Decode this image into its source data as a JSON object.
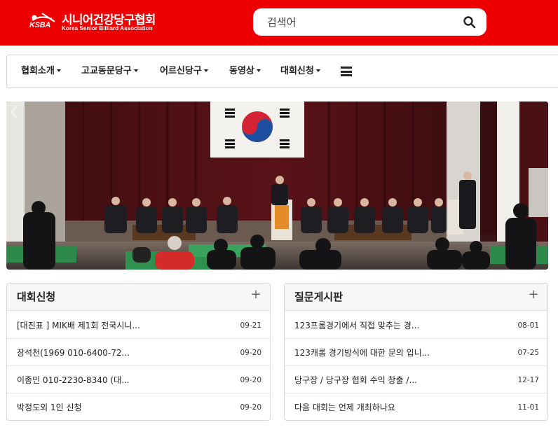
{
  "header": {
    "logo_mark": "KSBA",
    "logo_title": "시니어건강당구협회",
    "logo_subtitle": "Korea Senior Billiard Association",
    "search_placeholder": "검색어",
    "brand_color": "#ee0000"
  },
  "nav": {
    "items": [
      {
        "label": "협회소개"
      },
      {
        "label": "고교동문당구"
      },
      {
        "label": "어르신당구"
      },
      {
        "label": "동영상"
      },
      {
        "label": "대회신청"
      }
    ],
    "menu_icon": "hamburger-icon"
  },
  "banner": {
    "icon_prev": "chevron-left-icon"
  },
  "boards": [
    {
      "title": "대회신청",
      "more_icon": "plus-icon",
      "rows": [
        {
          "text": "[대진표 ] MIK배 제1회 전국시니...",
          "date": "09-21"
        },
        {
          "text": "장석천(1969 010-6400-72...",
          "date": "09-20"
        },
        {
          "text": "이종민 010-2230-8340 (대...",
          "date": "09-20"
        },
        {
          "text": "박정도외 1인 신청",
          "date": "09-20"
        }
      ]
    },
    {
      "title": "질문게시판",
      "more_icon": "plus-icon",
      "rows": [
        {
          "text": "123프롬경기에서 직접 맞추는 경...",
          "date": "08-01"
        },
        {
          "text": "123캐롬 경기방식에 대한 문의 입니...",
          "date": "07-25"
        },
        {
          "text": "당구장 / 당구장 협회 수익 창출 /...",
          "date": "12-17"
        },
        {
          "text": "다음 대회는 언제 개최하나요",
          "date": "11-01"
        }
      ]
    }
  ]
}
